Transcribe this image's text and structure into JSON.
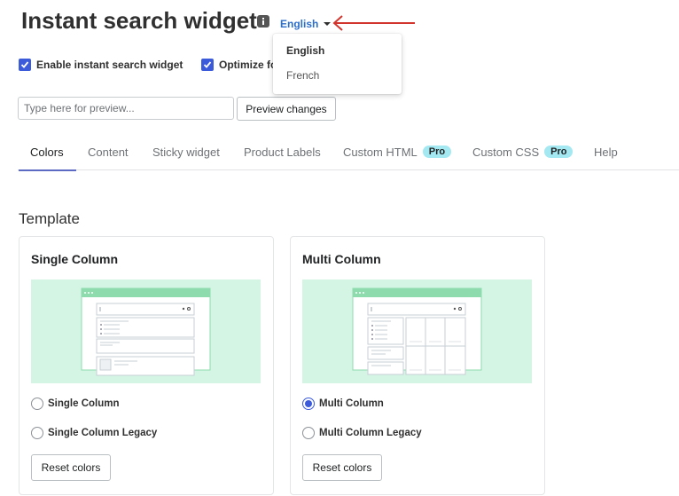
{
  "header": {
    "title": "Instant search widget",
    "language": "English"
  },
  "language_dropdown": {
    "options": [
      "English",
      "French"
    ],
    "selected": "English"
  },
  "settings": {
    "enable_label": "Enable instant search widget",
    "enable_checked": true,
    "optimize_label": "Optimize fo",
    "optimize_checked": true
  },
  "preview": {
    "placeholder": "Type here for preview...",
    "button_label": "Preview changes"
  },
  "tabs": [
    {
      "label": "Colors",
      "active": true
    },
    {
      "label": "Content",
      "active": false
    },
    {
      "label": "Sticky widget",
      "active": false
    },
    {
      "label": "Product Labels",
      "active": false
    },
    {
      "label": "Custom HTML",
      "badge": "Pro",
      "active": false
    },
    {
      "label": "Custom CSS",
      "badge": "Pro",
      "active": false
    },
    {
      "label": "Help",
      "active": false
    }
  ],
  "template": {
    "section_title": "Template",
    "cards": [
      {
        "title": "Single Column",
        "options": [
          "Single Column",
          "Single Column Legacy"
        ],
        "selected_index": null,
        "reset_label": "Reset colors"
      },
      {
        "title": "Multi Column",
        "options": [
          "Multi Column",
          "Multi Column Legacy"
        ],
        "selected_index": 0,
        "reset_label": "Reset colors"
      }
    ]
  },
  "colors": {
    "accent": "#3b5bdb",
    "link": "#2c6ecb",
    "thumbnail_bg": "#d4f4e4",
    "thumbnail_frame": "#8edcae",
    "annotation_arrow": "#d0342c",
    "pro_badge": "#a4e8f2"
  }
}
